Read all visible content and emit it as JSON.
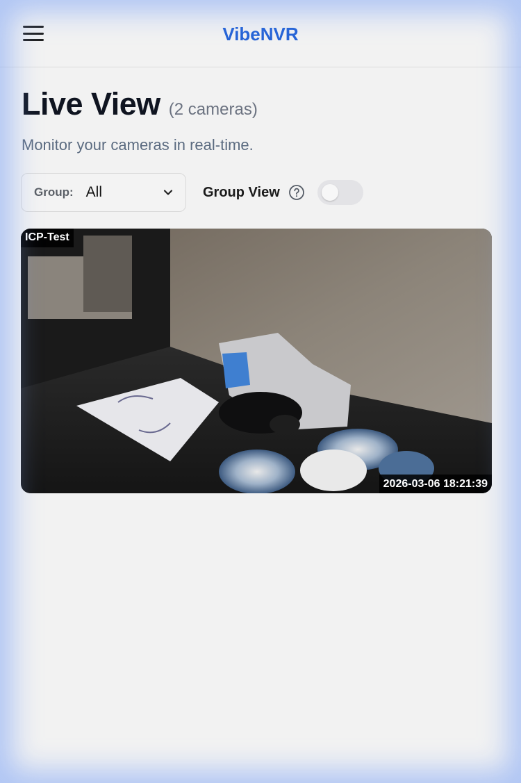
{
  "header": {
    "brand": "VibeNVR",
    "menu_icon": "hamburger-menu-icon"
  },
  "page": {
    "title": "Live View",
    "camera_count": "(2 cameras)",
    "subtitle": "Monitor your cameras in real-time."
  },
  "filters": {
    "group_label": "Group:",
    "group_value": "All",
    "group_view_label": "Group View",
    "group_view_enabled": false,
    "help_icon": "question-circle-icon"
  },
  "cameras": [
    {
      "name": "ICP-Test",
      "timestamp": "2026-03-06 18:21:39"
    }
  ],
  "colors": {
    "brand": "#2563d6",
    "background": "#f2f2f2",
    "toggle_off": "#e3e3e6"
  }
}
